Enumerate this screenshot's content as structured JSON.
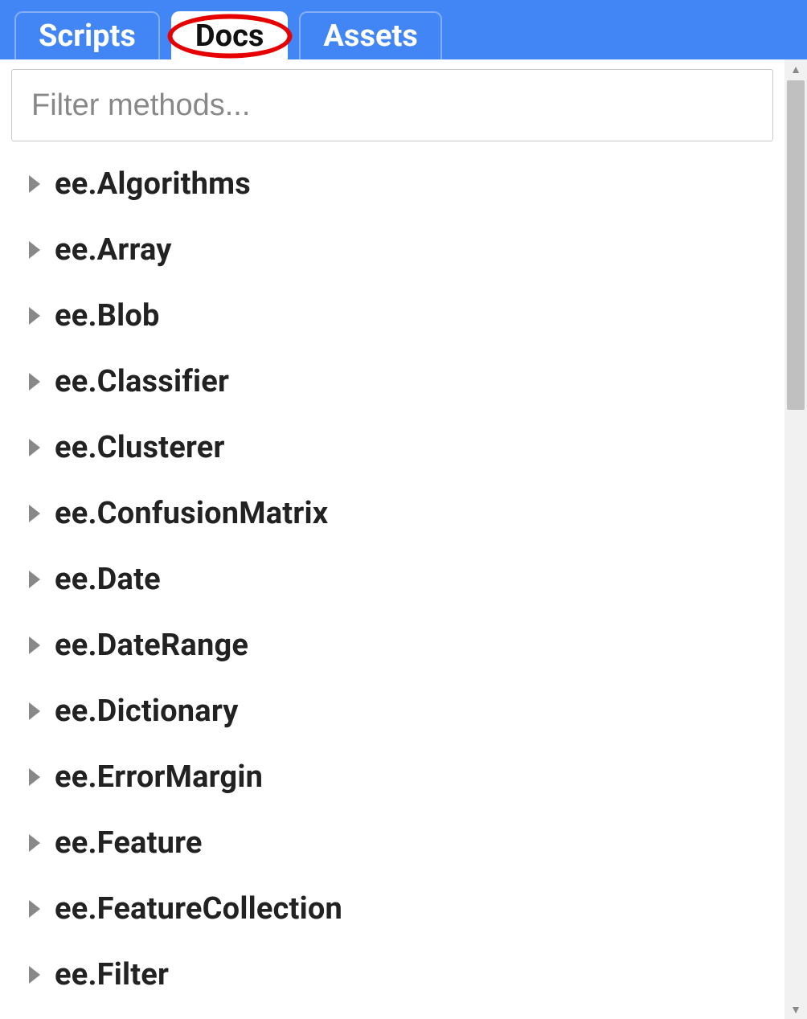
{
  "tabs": [
    {
      "label": "Scripts",
      "active": false
    },
    {
      "label": "Docs",
      "active": true,
      "annotated": true
    },
    {
      "label": "Assets",
      "active": false
    }
  ],
  "filter": {
    "placeholder": "Filter methods...",
    "value": ""
  },
  "tree": [
    {
      "label": "ee.Algorithms"
    },
    {
      "label": "ee.Array"
    },
    {
      "label": "ee.Blob"
    },
    {
      "label": "ee.Classifier"
    },
    {
      "label": "ee.Clusterer"
    },
    {
      "label": "ee.ConfusionMatrix"
    },
    {
      "label": "ee.Date"
    },
    {
      "label": "ee.DateRange"
    },
    {
      "label": "ee.Dictionary"
    },
    {
      "label": "ee.ErrorMargin"
    },
    {
      "label": "ee.Feature"
    },
    {
      "label": "ee.FeatureCollection"
    },
    {
      "label": "ee.Filter"
    }
  ]
}
